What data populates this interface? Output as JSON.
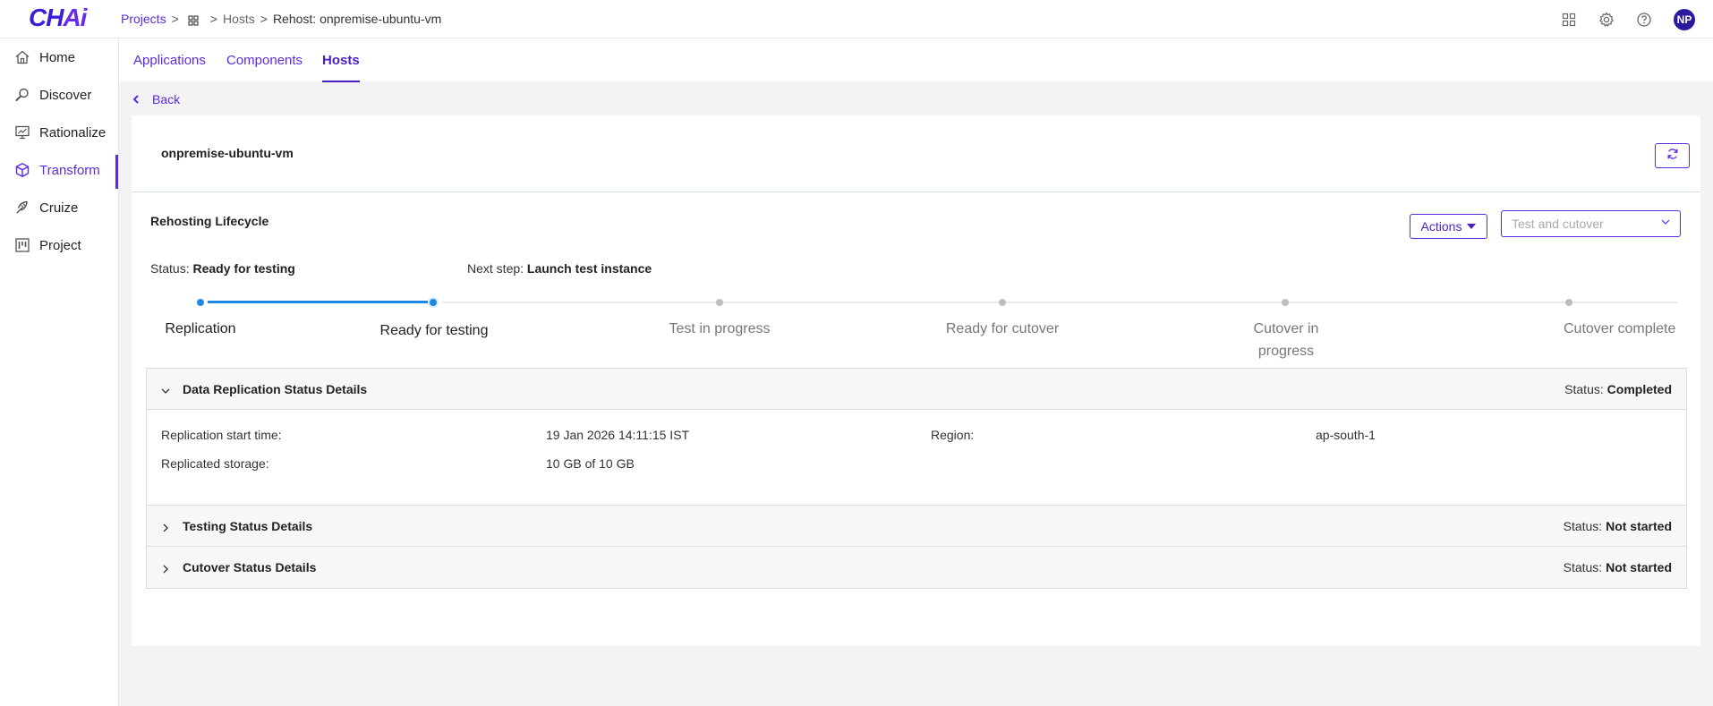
{
  "brand": {
    "logo_main": "CH",
    "logo_accent": "Ai"
  },
  "breadcrumb": {
    "projects": "Projects",
    "hosts": "Hosts",
    "current": "Rehost: onpremise-ubuntu-vm"
  },
  "topbar": {
    "avatar_initials": "NP"
  },
  "sidebar": {
    "items": [
      {
        "label": "Home",
        "icon": "home-icon"
      },
      {
        "label": "Discover",
        "icon": "discover-icon"
      },
      {
        "label": "Rationalize",
        "icon": "rationalize-icon"
      },
      {
        "label": "Transform",
        "icon": "transform-icon",
        "active": true
      },
      {
        "label": "Cruize",
        "icon": "cruize-icon"
      },
      {
        "label": "Project",
        "icon": "project-icon"
      }
    ]
  },
  "tabs": [
    {
      "label": "Applications"
    },
    {
      "label": "Components"
    },
    {
      "label": "Hosts",
      "active": true
    }
  ],
  "back_label": "Back",
  "host": {
    "name": "onpremise-ubuntu-vm"
  },
  "lifecycle": {
    "title": "Rehosting Lifecycle",
    "actions_label": "Actions",
    "phase_placeholder": "Test and cutover",
    "status_label": "Status:",
    "status_value": "Ready for testing",
    "next_step_label": "Next step:",
    "next_step_value": "Launch test instance",
    "steps": [
      {
        "label": "Replication",
        "state": "done"
      },
      {
        "label": "Ready for testing",
        "state": "current"
      },
      {
        "label": "Test in progress",
        "state": "pending"
      },
      {
        "label": "Ready for cutover",
        "state": "pending"
      },
      {
        "label": "Cutover in progress",
        "state": "pending"
      },
      {
        "label": "Cutover complete",
        "state": "pending"
      }
    ]
  },
  "sections": {
    "replication": {
      "title": "Data Replication Status Details",
      "status_label": "Status:",
      "status_value": "Completed",
      "start_time_label": "Replication start time:",
      "start_time_value": "19 Jan 2026 14:11:15 IST",
      "region_label": "Region:",
      "region_value": "ap-south-1",
      "storage_label": "Replicated storage:",
      "storage_value": "10 GB of 10 GB"
    },
    "testing": {
      "title": "Testing Status Details",
      "status_label": "Status:",
      "status_value": "Not started"
    },
    "cutover": {
      "title": "Cutover Status Details",
      "status_label": "Status:",
      "status_value": "Not started"
    }
  },
  "colors": {
    "accent": "#5b2be0",
    "progress": "#1e88e5",
    "brand": "#3a1fd6"
  }
}
